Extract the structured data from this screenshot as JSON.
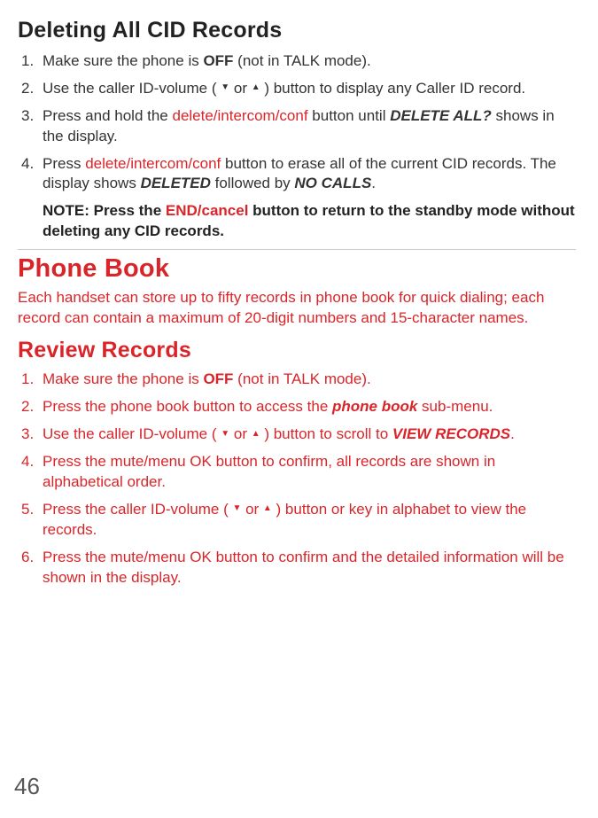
{
  "section1": {
    "title": "Deleting All CID Records",
    "items": {
      "1": {
        "pre": "Make sure the phone is ",
        "bold": "OFF",
        "post": " (not in TALK mode)."
      },
      "2": {
        "pre": "Use the caller ID-volume ( ",
        "down": "▼",
        "mid": " or ",
        "up": "▲",
        "post": " ) button to display any Caller ID record."
      },
      "3": {
        "pre": "Press and hold the ",
        "red": "delete/intercom/conf",
        "mid": " button until ",
        "bolditalic": "DELETE ALL?",
        "post": " shows in the display."
      },
      "4": {
        "pre": "Press ",
        "red": "delete/intercom/conf",
        "mid": " button to erase all of the current CID records. The display shows ",
        "bolditalic1": "DELETED",
        "mid2": " followed by ",
        "bolditalic2": "NO CALLS",
        "post": "."
      }
    },
    "note": {
      "pre": "NOTE: Press the ",
      "red": "END/cancel",
      "post": " button to return to the standby mode without deleting any CID records."
    }
  },
  "section2": {
    "title": "Phone Book",
    "intro": "Each handset can store up to fifty records in phone book for quick dialing; each record can contain a maximum of 20-digit numbers and 15-character names."
  },
  "section3": {
    "title": "Review Records",
    "items": {
      "1": {
        "pre": "Make sure the phone is ",
        "bold": "OFF",
        "post": " (not in TALK mode)."
      },
      "2": {
        "pre": "Press the phone book button to access the ",
        "bolditalic": "phone book",
        "post": " sub-menu."
      },
      "3": {
        "pre": "Use the caller ID-volume ( ",
        "down": "▼",
        "mid": " or ",
        "up": "▲",
        "mid2": " ) button to scroll to ",
        "bolditalic": "VIEW RECORDS",
        "post": "."
      },
      "4": {
        "text": "Press the mute/menu OK button to confirm, all records are shown in alphabetical order."
      },
      "5": {
        "pre": "Press the caller ID-volume ( ",
        "down": "▼",
        "mid": " or ",
        "up": "▲",
        "post": " ) button or key in alphabet to view the records."
      },
      "6": {
        "text": "Press the mute/menu OK button to confirm and the detailed information will be shown in the display."
      }
    }
  },
  "page_number": "46"
}
